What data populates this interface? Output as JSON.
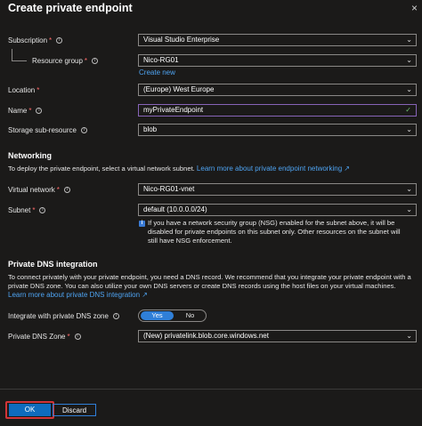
{
  "header": {
    "title": "Create private endpoint",
    "close_label": "×"
  },
  "subscription": {
    "label": "Subscription",
    "value": "Visual Studio Enterprise"
  },
  "resource_group": {
    "label": "Resource group",
    "value": "Nico-RG01",
    "create_new": "Create new"
  },
  "location": {
    "label": "Location",
    "value": "(Europe) West Europe"
  },
  "name": {
    "label": "Name",
    "value": "myPrivateEndpoint"
  },
  "storage_sub_resource": {
    "label": "Storage sub-resource",
    "value": "blob"
  },
  "networking": {
    "heading": "Networking",
    "description": "To deploy the private endpoint, select a virtual network subnet.",
    "learn_more": "Learn more about private endpoint networking",
    "virtual_network": {
      "label": "Virtual network",
      "value": "Nico-RG01-vnet"
    },
    "subnet": {
      "label": "Subnet",
      "value": "default (10.0.0.0/24)"
    },
    "nsg_notice": [
      "If you have a network security group (NSG) enabled for the subnet above, it will be",
      "disabled for private endpoints on this subnet only. Other resources on the subnet will",
      "still have NSG enforcement."
    ]
  },
  "dns": {
    "heading": "Private DNS integration",
    "description": [
      "To connect privately with your private endpoint, you need a DNS record. We recommend that you integrate your private endpoint with a",
      "private DNS zone. You can also utilize your own DNS servers or create DNS records using the host files on your virtual machines."
    ],
    "learn_more": "Learn more about private DNS integration",
    "integrate": {
      "label": "Integrate with private DNS zone",
      "yes": "Yes",
      "no": "No",
      "selected": "Yes"
    },
    "zone": {
      "label": "Private DNS Zone",
      "value": "(New) privatelink.blob.core.windows.net"
    }
  },
  "footer": {
    "ok_label": "OK",
    "discard_label": "Discard"
  },
  "icons": {
    "info": "info-circle-icon",
    "chevron": "chevron-down-icon",
    "check": "checkmark-icon",
    "external": "external-link-icon",
    "notice": "info-square-icon"
  },
  "colors": {
    "background": "#1b1a19",
    "accent": "#2f7fd8",
    "link": "#4ea3f1",
    "required": "#ff6b6b",
    "ok_highlight": "#d13438",
    "focus_border": "#8764b8"
  }
}
